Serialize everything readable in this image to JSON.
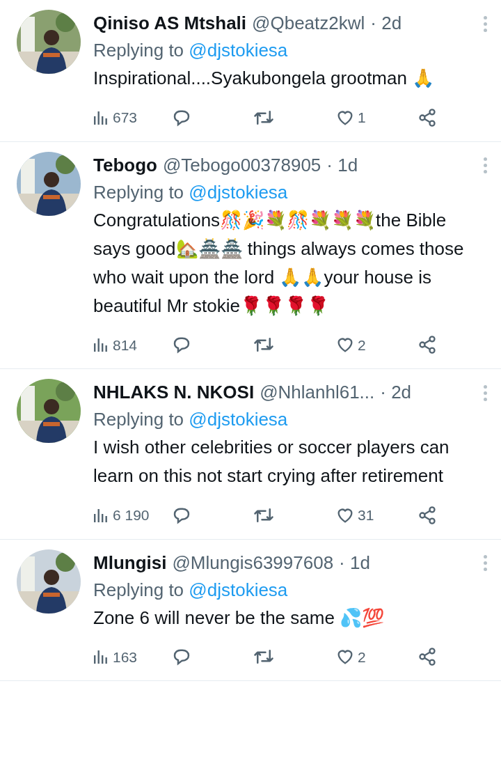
{
  "replies": [
    {
      "name": "Qiniso AS Mtshali",
      "handle": "@Qbeatz2kwl",
      "time": "· 2d",
      "replying_label": "Replying to",
      "replying_to": "@djstokiesa",
      "text": "Inspirational....Syakubongela grootman 🙏",
      "views": "673",
      "likes": "1"
    },
    {
      "name": "Tebogo",
      "handle": "@Tebogo00378905",
      "time": "· 1d",
      "replying_label": "Replying to",
      "replying_to": "@djstokiesa",
      "text": "Congratulations🎊🎉💐🎊💐💐💐the Bible says good🏡🏯🏯 things always comes those who wait upon the lord 🙏🙏your house is beautiful Mr stokie🌹🌹🌹🌹",
      "views": "814",
      "likes": "2"
    },
    {
      "name": "NHLAKS N. NKOSI",
      "handle": "@Nhlanhl61...",
      "time": "· 2d",
      "replying_label": "Replying to",
      "replying_to": "@djstokiesa",
      "text": "I wish other celebrities or soccer players can learn on this not start crying after retirement",
      "views": "6 190",
      "likes": "31"
    },
    {
      "name": "Mlungisi",
      "handle": "@Mlungis63997608",
      "time": "· 1d",
      "replying_label": "Replying to",
      "replying_to": "@djstokiesa",
      "text": "Zone 6 will never be the same 💦💯",
      "views": "163",
      "likes": "2"
    }
  ]
}
